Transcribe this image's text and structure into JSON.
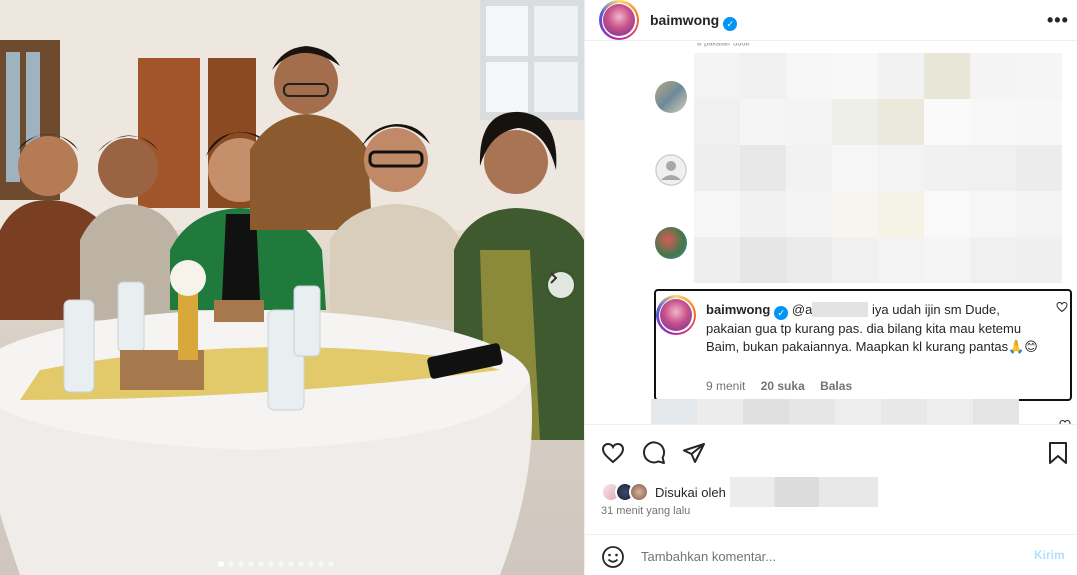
{
  "post": {
    "username": "baimwong",
    "more_label": "•••"
  },
  "comments": {
    "cut_off_text": "ᵃ ᵖᵃᵏᵃᶦᵃⁿ ᵈᵘᵈᵉ",
    "reply": {
      "username": "baimwong",
      "mention_prefix": "@a",
      "text": "iya udah ijin sm Dude, pakaian gua tp kurang pas. dia bilang kita mau ketemu Baim, bukan pakaiannya. Maapkan kl kurang pantas🙏😊",
      "time": "9 menit",
      "likes": "20 suka",
      "reply_label": "Balas"
    }
  },
  "engagement": {
    "liked_by_prefix": "Disukai oleh",
    "time_ago": "31 menit yang lalu"
  },
  "add_comment": {
    "placeholder": "Tambahkan komentar...",
    "post_label": "Kirim"
  },
  "carousel": {
    "slide_count": 12,
    "active_index": 0
  },
  "colors": {
    "verified": "#0095f6",
    "post_button_disabled": "#b2dffc",
    "accent_jacket": "#1f7a3c"
  }
}
